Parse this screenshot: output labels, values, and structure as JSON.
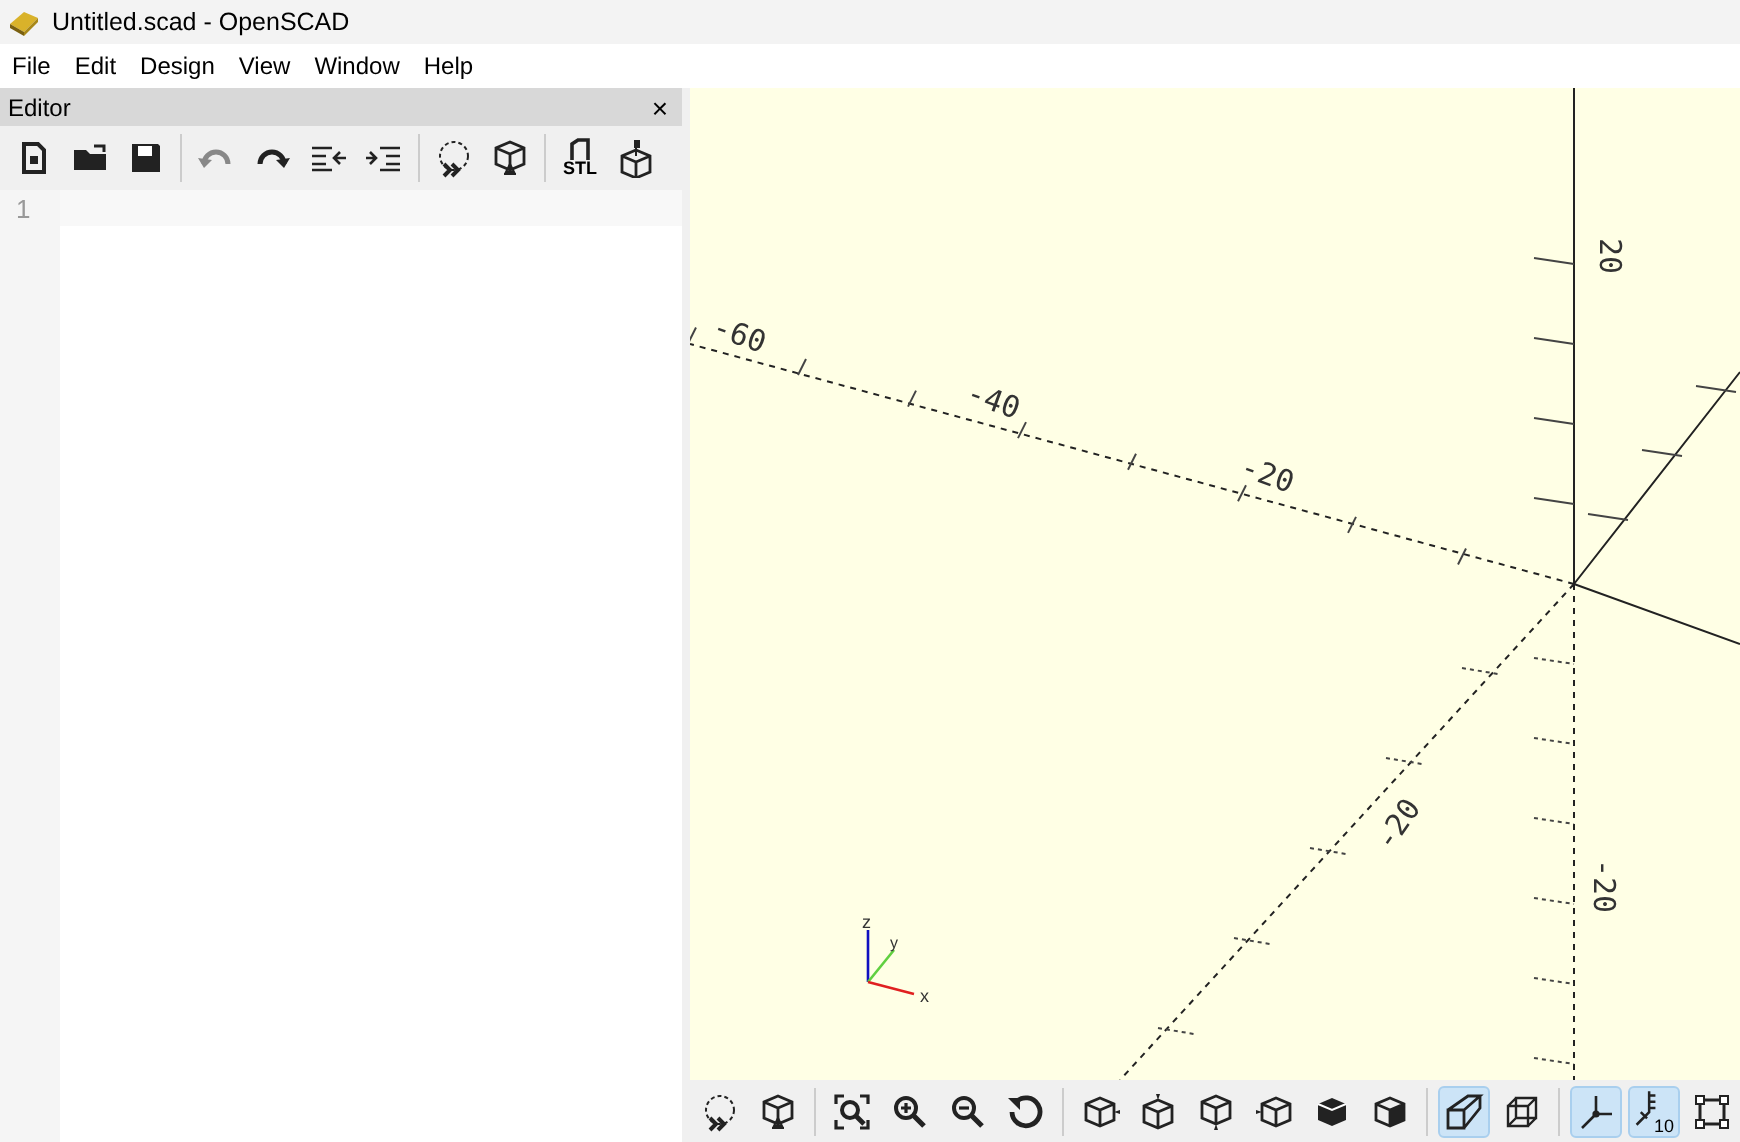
{
  "window": {
    "title": "Untitled.scad - OpenSCAD"
  },
  "menu": [
    "File",
    "Edit",
    "Design",
    "View",
    "Window",
    "Help"
  ],
  "editor_panel": {
    "title": "Editor",
    "close": "×",
    "line_numbers": [
      "1"
    ]
  },
  "editor_toolbar": [
    {
      "kind": "new"
    },
    {
      "kind": "open"
    },
    {
      "kind": "save"
    },
    {
      "kind": "sep"
    },
    {
      "kind": "undo"
    },
    {
      "kind": "redo"
    },
    {
      "kind": "unindent"
    },
    {
      "kind": "indent"
    },
    {
      "kind": "sep"
    },
    {
      "kind": "preview"
    },
    {
      "kind": "render"
    },
    {
      "kind": "sep"
    },
    {
      "kind": "stl",
      "label": "STL"
    },
    {
      "kind": "print"
    }
  ],
  "viewport": {
    "axis_labels": [
      "-60",
      "-40",
      "-20",
      "20",
      "-20",
      "-20"
    ],
    "axes_indicator": [
      "z",
      "y",
      "x"
    ]
  },
  "view_toolbar": [
    {
      "kind": "preview",
      "selected": false
    },
    {
      "kind": "render",
      "selected": false
    },
    {
      "kind": "sep"
    },
    {
      "kind": "viewall",
      "selected": false
    },
    {
      "kind": "zoomin",
      "selected": false
    },
    {
      "kind": "zoomout",
      "selected": false
    },
    {
      "kind": "reset",
      "selected": false
    },
    {
      "kind": "sep"
    },
    {
      "kind": "right",
      "selected": false
    },
    {
      "kind": "top",
      "selected": false
    },
    {
      "kind": "bottom",
      "selected": false
    },
    {
      "kind": "left",
      "selected": false
    },
    {
      "kind": "front",
      "selected": false
    },
    {
      "kind": "back",
      "selected": false
    },
    {
      "kind": "sep"
    },
    {
      "kind": "perspective",
      "selected": true
    },
    {
      "kind": "orthogonal",
      "selected": false
    },
    {
      "kind": "sep"
    },
    {
      "kind": "axes",
      "selected": true
    },
    {
      "kind": "scale",
      "selected": true,
      "label": "10"
    },
    {
      "kind": "edges",
      "selected": false
    }
  ]
}
